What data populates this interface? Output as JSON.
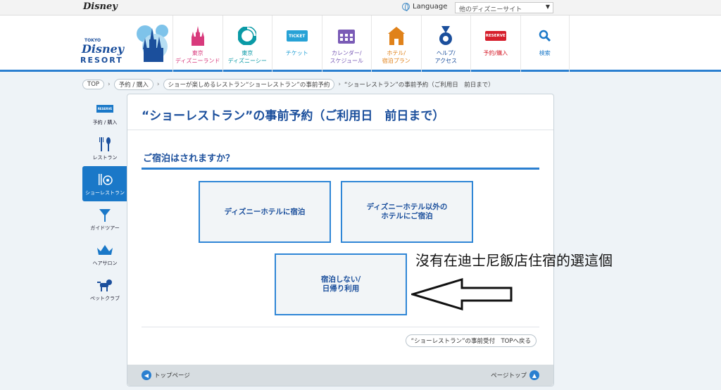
{
  "topbar": {
    "brand": "Disney",
    "language_label": "Language",
    "other_sites_value": "他のディズニーサイト"
  },
  "logo": {
    "tokyo": "TOKYO",
    "name": "Disney",
    "resort": "RESORT"
  },
  "nav": [
    {
      "label": "東京\nディズニーランド",
      "icon": "castle-icon",
      "color": "#d83a7c"
    },
    {
      "label": "東京\nディズニーシー",
      "icon": "lifering-icon",
      "color": "#0a9aa6"
    },
    {
      "label": "チケット",
      "icon": "ticket-icon",
      "icon_text": "TICKET",
      "color": "#27a2d6"
    },
    {
      "label": "カレンダー/\nスケジュール",
      "icon": "calendar-icon",
      "color": "#7a5bb6"
    },
    {
      "label": "ホテル/\n宿泊プラン",
      "icon": "hotel-icon",
      "color": "#e0821a"
    },
    {
      "label": "ヘルプ/\nアクセス",
      "icon": "medal-icon",
      "color": "#1b4f9c"
    },
    {
      "label": "予約/購入",
      "icon": "reserve-icon",
      "icon_text": "RESERVE",
      "color": "#d61f2c"
    },
    {
      "label": "検索",
      "icon": "search-icon",
      "color": "#1a78c8"
    }
  ],
  "breadcrumb": [
    {
      "label": "TOP",
      "pill": true
    },
    {
      "label": "予約 / 購入",
      "pill": true
    },
    {
      "label": "ショーが楽しめるレストラン“ショーレストラン”の事前予約",
      "pill": true
    },
    {
      "label": "“ショーレストラン”の事前予約（ご利用日　前日まで）",
      "pill": false
    }
  ],
  "sidebar": [
    {
      "label": "予約 / 購入",
      "icon": "reserve-icon",
      "icon_text": "RESERVE",
      "active": false
    },
    {
      "label": "レストラン",
      "icon": "cutlery-icon",
      "active": false
    },
    {
      "label": "ショーレストラン",
      "icon": "show-restaurant-icon",
      "active": true
    },
    {
      "label": "ガイドツアー",
      "icon": "flag-icon",
      "active": false
    },
    {
      "label": "ヘアサロン",
      "icon": "crown-icon",
      "active": false
    },
    {
      "label": "ペットクラブ",
      "icon": "dog-icon",
      "active": false
    }
  ],
  "main": {
    "title": "“ショーレストラン”の事前予約（ご利用日　前日まで）",
    "question": "ご宿泊はされますか？",
    "choices": [
      "ディズニーホテルに宿泊",
      "ディズニーホテル以外の\nホテルにご宿泊",
      "宿泊しない/\n日帰り利用"
    ],
    "back_link": "“ショーレストラン”の事前受付　TOPへ戻る",
    "footer_left": "トップページ",
    "footer_right": "ページトップ"
  },
  "annotation": {
    "text": "沒有在迪士尼飯店住宿的選這個"
  }
}
